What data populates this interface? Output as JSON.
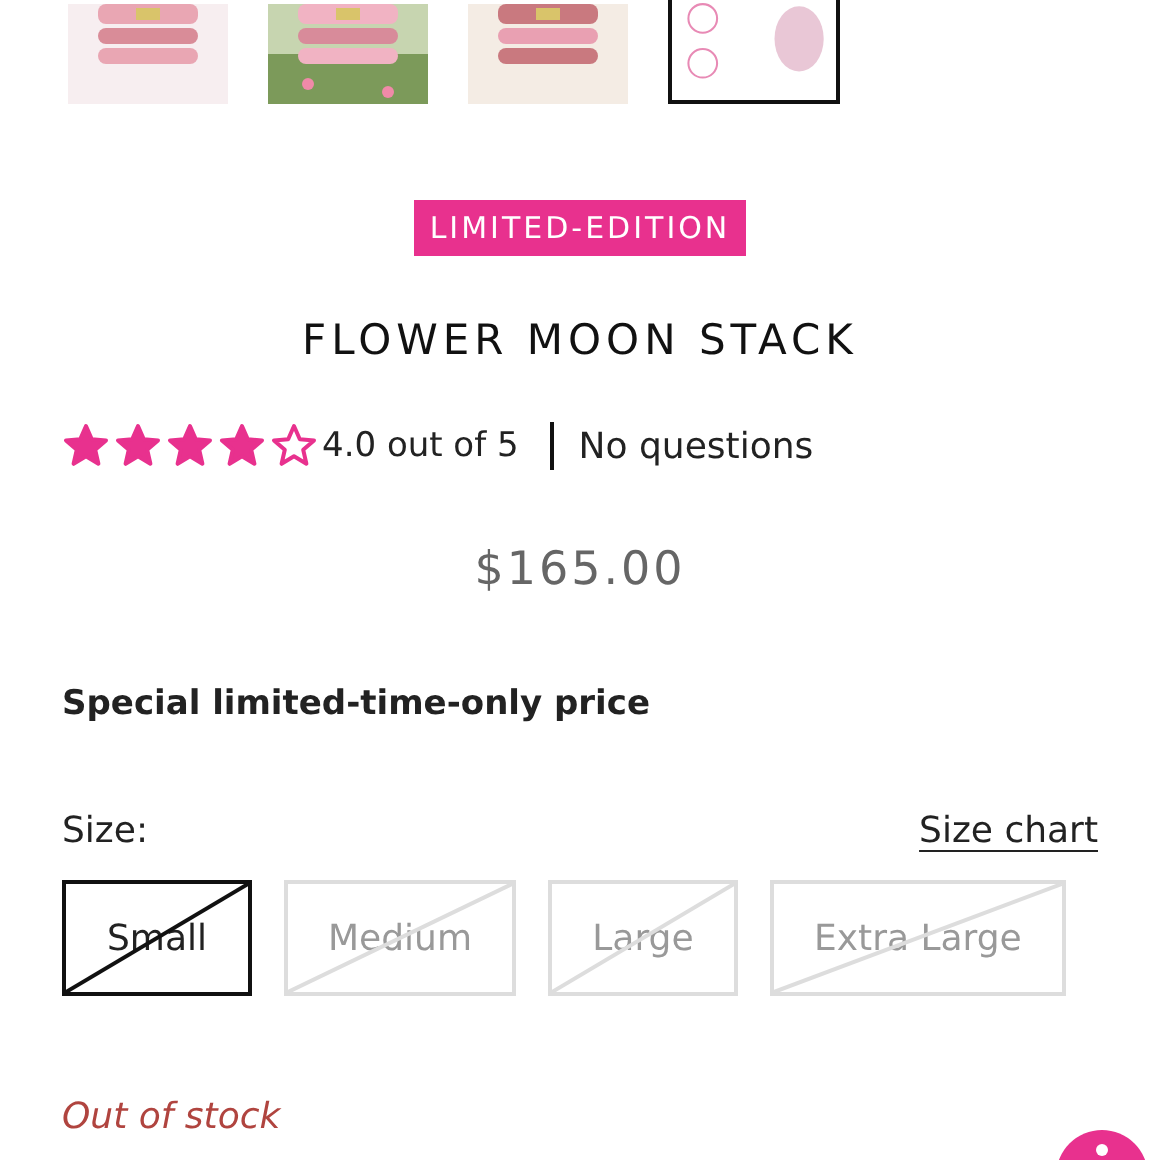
{
  "thumbnails": [
    {
      "kind": "picture",
      "selected": false
    },
    {
      "kind": "picture",
      "selected": false
    },
    {
      "kind": "picture",
      "selected": false
    },
    {
      "kind": "picture",
      "selected": true
    }
  ],
  "badge": "LIMITED-EDITION",
  "title": "FLOWER MOON STACK",
  "rating": {
    "stars": 4,
    "text": "4.0 out of 5",
    "questions": "No questions"
  },
  "price": "$165.00",
  "promo": "Special limited-time-only price",
  "size": {
    "label": "Size:",
    "chart_link": "Size chart",
    "options": [
      {
        "label": "Small",
        "selected": true,
        "available": false
      },
      {
        "label": "Medium",
        "selected": false,
        "available": false
      },
      {
        "label": "Large",
        "selected": false,
        "available": false
      },
      {
        "label": "Extra Large",
        "selected": false,
        "available": false
      }
    ]
  },
  "stock": "Out of stock"
}
